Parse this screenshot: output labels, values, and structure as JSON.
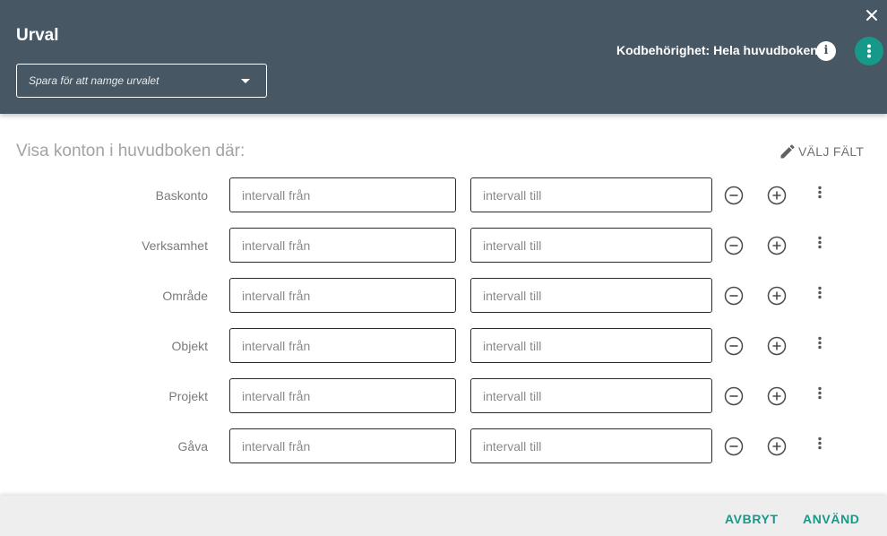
{
  "header": {
    "title": "Urval",
    "save_placeholder": "Spara för att namge urvalet",
    "permission_text": "Kodbehörighet: Hela huvudboken",
    "info_glyph": "i",
    "icons": [
      "close-icon",
      "info-icon",
      "more-vert-icon",
      "chevron-down-icon"
    ],
    "accent_color": "#17998a",
    "bar_color": "#475763"
  },
  "main": {
    "subtitle": "Visa konton i huvudboken där:",
    "choose_fields_label": "VÄLJ FÄLT",
    "from_placeholder": "intervall från",
    "to_placeholder": "intervall till",
    "rows": [
      {
        "label": "Baskonto"
      },
      {
        "label": "Verksamhet"
      },
      {
        "label": "Område"
      },
      {
        "label": "Objekt"
      },
      {
        "label": "Projekt"
      },
      {
        "label": "Gåva"
      }
    ]
  },
  "footer": {
    "cancel_label": "AVBRYT",
    "apply_label": "ANVÄND"
  }
}
